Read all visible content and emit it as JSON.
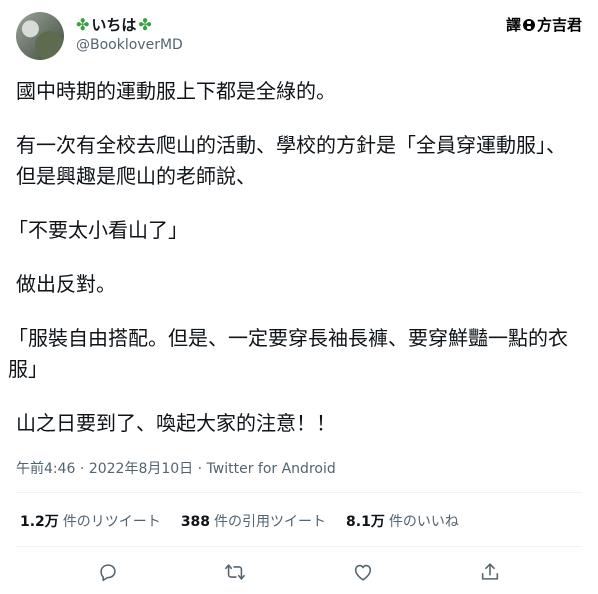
{
  "user": {
    "display_name": "いちは",
    "clover_glyph": "✤",
    "handle": "@BookloverMD"
  },
  "watermark": {
    "left": "譯",
    "right": "方吉君"
  },
  "tweet": {
    "paragraphs": [
      "國中時期的運動服上下都是全綠的。",
      "有一次有全校去爬山的活動、學校的方針是「全員穿運動服」、但是興趣是爬山的老師說、",
      "「不要太小看山了」",
      "做出反對。",
      "「服裝自由搭配。但是、一定要穿長袖長褲、要穿鮮豔一點的衣服」",
      "山之日要到了、喚起大家的注意！！"
    ]
  },
  "meta": {
    "time": "午前4:46",
    "sep1": " · ",
    "date": "2022年8月10日",
    "sep2": " · ",
    "source": "Twitter for Android"
  },
  "stats": {
    "retweets_count": "1.2万",
    "retweets_label": "件のリツイート",
    "quotes_count": "388",
    "quotes_label": "件の引用ツイート",
    "likes_count": "8.1万",
    "likes_label": "件のいいね"
  },
  "actions": [
    "reply-icon",
    "retweet-icon",
    "like-icon",
    "share-icon"
  ],
  "colors": {
    "text": "#0f1419",
    "secondary": "#536471",
    "divider": "#eff3f4",
    "clover": "#3aa043"
  }
}
